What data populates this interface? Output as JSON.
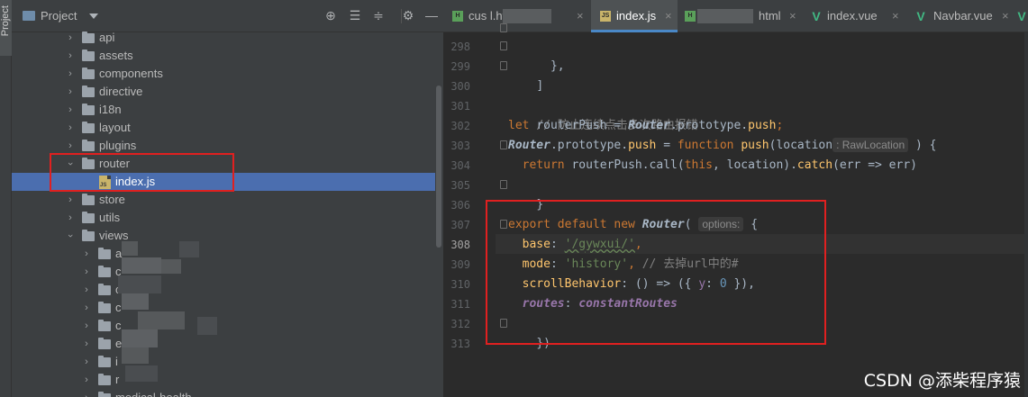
{
  "tool_strip": {
    "tab_label": "Project"
  },
  "project": {
    "title": "Project",
    "header_icons": [
      "locate-icon",
      "expand-all-icon",
      "collapse-all-icon",
      "gear-icon",
      "hide-icon"
    ],
    "tree": [
      {
        "label": "api",
        "type": "folder",
        "expanded": false
      },
      {
        "label": "assets",
        "type": "folder",
        "expanded": false
      },
      {
        "label": "components",
        "type": "folder",
        "expanded": false
      },
      {
        "label": "directive",
        "type": "folder",
        "expanded": false
      },
      {
        "label": "i18n",
        "type": "folder",
        "expanded": false
      },
      {
        "label": "layout",
        "type": "folder",
        "expanded": false
      },
      {
        "label": "plugins",
        "type": "folder",
        "expanded": false
      },
      {
        "label": "router",
        "type": "folder",
        "expanded": true
      },
      {
        "label": "index.js",
        "type": "js-file",
        "selected": true
      },
      {
        "label": "store",
        "type": "folder",
        "expanded": false
      },
      {
        "label": "utils",
        "type": "folder",
        "expanded": false
      },
      {
        "label": "views",
        "type": "folder",
        "expanded": true
      },
      {
        "label": "a",
        "type": "folder",
        "expanded": false
      },
      {
        "label": "c",
        "type": "folder",
        "expanded": false
      },
      {
        "label": "c",
        "type": "folder",
        "expanded": false
      },
      {
        "label": "c",
        "type": "folder",
        "expanded": false
      },
      {
        "label": "c",
        "type": "folder",
        "expanded": false
      },
      {
        "label": "e",
        "type": "folder",
        "expanded": false
      },
      {
        "label": "i",
        "type": "folder",
        "expanded": false
      },
      {
        "label": "r",
        "type": "folder",
        "expanded": false
      },
      {
        "label": "medical-health",
        "type": "folder",
        "expanded": false
      }
    ]
  },
  "editor": {
    "tabs": [
      {
        "label": "cus     l.html",
        "icon": "html-file-icon",
        "active": false
      },
      {
        "label": "index.js",
        "icon": "js-file-icon",
        "active": true
      },
      {
        "label": "html",
        "icon": "html-file-icon",
        "active": false
      },
      {
        "label": "index.vue",
        "icon": "vue-file-icon",
        "active": false
      },
      {
        "label": "Navbar.vue",
        "icon": "vue-file-icon",
        "active": false
      },
      {
        "label": "i",
        "icon": "vue-file-icon",
        "active": false
      }
    ],
    "line_numbers": [
      "298",
      "299",
      "300",
      "301",
      "302",
      "303",
      "304",
      "305",
      "306",
      "307",
      "308",
      "309",
      "310",
      "311",
      "312",
      "313"
    ],
    "current_line": "308",
    "code": {
      "l298_a": "  },",
      "l299_a": "]",
      "l301_a": "// 防止连续点击多次路由报错",
      "l302_kw": "let ",
      "l302_var": "routerPush = ",
      "l302_cls": "Router",
      "l302_rest": ".prototype.",
      "l302_push": "push",
      "l302_end": ";",
      "l303_cls": "Router",
      "l303_proto": ".prototype.",
      "l303_push": "push",
      "l303_eq": " = ",
      "l303_fn": "function ",
      "l303_name": "push",
      "l303_open": "(location",
      "l303_hint": ": RawLocation",
      "l303_close": " ) {",
      "l304_kw": "  return ",
      "l304_a": "routerPush.call(",
      "l304_this": "this",
      "l304_b": ", location).",
      "l304_catch": "catch",
      "l304_c": "(err => err)",
      "l305_a": "}",
      "l307_kw": "export default new ",
      "l307_cls": "Router",
      "l307_open": "( ",
      "l307_hint": "options:",
      "l307_brace": " {",
      "l308_prop": "  base",
      "l308_colon": ": ",
      "l308_str": "'/gywxui/'",
      "l308_end": ",",
      "l309_prop": "  mode",
      "l309_colon": ": ",
      "l309_str": "'history'",
      "l309_comma": ", ",
      "l309_cmt": "// 去掉url中的#",
      "l310_prop": "  scrollBehavior",
      "l310_a": ": () => ({ ",
      "l310_y": "y",
      "l310_colon": ": ",
      "l310_num": "0",
      "l310_end": " }),",
      "l311_prop": "  routes",
      "l311_colon": ": ",
      "l311_val": "constantRoutes",
      "l312_a": "})"
    }
  },
  "watermark": "CSDN @添柴程序猿",
  "colors": {
    "selection": "#4b6eaf",
    "annotation_box": "#e02020",
    "active_tab_underline": "#4a88c7"
  }
}
